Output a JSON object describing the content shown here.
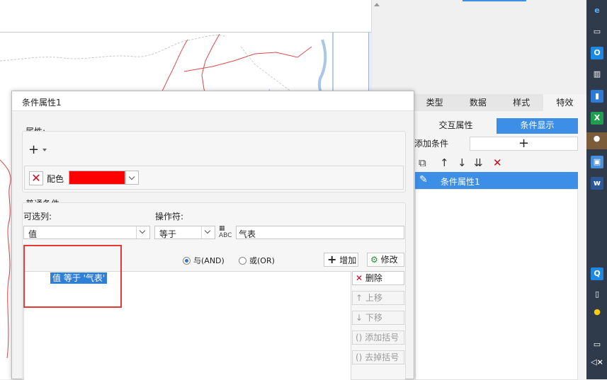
{
  "right_panel": {
    "tabs": [
      "类型",
      "数据",
      "样式",
      "特效"
    ],
    "active_tab": 3,
    "sub_tabs": [
      "交互属性",
      "条件显示"
    ],
    "active_sub_tab": 1,
    "add_condition_label": "添加条件",
    "add_condition_icon": "plus-icon",
    "toolbar_icons": [
      "copy-icon",
      "move-up-icon",
      "move-down-icon",
      "move-bottom-icon",
      "delete-icon"
    ],
    "condition_items": [
      {
        "label": "条件属性1",
        "icon": "pencil-icon"
      }
    ]
  },
  "dialog": {
    "title": "条件属性1",
    "attributes": {
      "label": "属性:",
      "add_icon": "plus-icon",
      "color_row": {
        "remove_icon": "red-x-icon",
        "label": "配色",
        "color": "#ff0000"
      }
    },
    "normal_condition": {
      "label": "普通条件",
      "column_label": "可选列:",
      "column_value": "值",
      "operator_label": "操作符:",
      "operator_value": "等于",
      "value_text": "气表",
      "radio_and": "与(AND)",
      "radio_or": "或(OR)",
      "selected_radio": "and",
      "add_button": "增加",
      "modify_button": "修改",
      "delete_button": "删除",
      "move_up_button": "上移",
      "move_down_button": "下移",
      "add_bracket_button": "添加括号",
      "remove_bracket_button": "去掉括号",
      "conditions": [
        "值 等于 '气表'"
      ]
    }
  },
  "taskbar": {
    "icons": [
      "ie-icon",
      "network-icon",
      "qq-browser-icon",
      "word-icon",
      "app-icon",
      "excel-icon",
      "wechat-icon",
      "image-icon",
      "word-icon",
      "qq-icon",
      "phone-icon",
      "penguin-icon",
      "battery-icon",
      "volume-mute-icon"
    ]
  },
  "colors": {
    "accent": "#3d8ee6",
    "selection": "#2f7fd8",
    "annotation": "#e53935"
  }
}
